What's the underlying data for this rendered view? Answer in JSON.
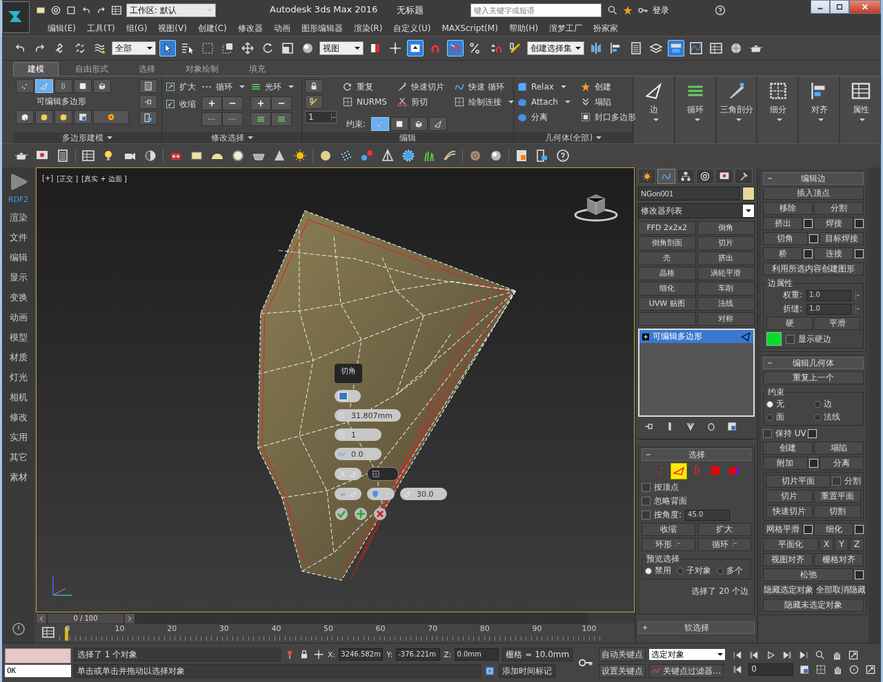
{
  "window": {
    "title": "Autodesk 3ds Max 2016",
    "document": "无标题",
    "workspace": "工作区: 默认",
    "search": {
      "placeholder": "键入关键字或短语"
    },
    "user": "登录"
  },
  "menu": [
    "编辑(E)",
    "工具(T)",
    "组(G)",
    "视图(V)",
    "创建(C)",
    "修改器",
    "动画",
    "图形编辑器",
    "渲染(R)",
    "自定义(U)",
    "MAXScript(M)",
    "帮助(H)",
    "渲梦工厂",
    "扮家家"
  ],
  "main_toolbar": [
    {
      "kind": "undo",
      "on": false
    },
    {
      "kind": "redo",
      "on": false
    },
    {
      "kind": "chain",
      "on": false
    },
    {
      "kind": "unchain",
      "on": false
    },
    {
      "kind": "wave",
      "on": false
    },
    {
      "kind": "dropdown",
      "value": "全部"
    },
    {
      "kind": "cursor",
      "on": true
    },
    {
      "kind": "cursorlist",
      "on": false
    },
    {
      "kind": "marquee",
      "on": false
    },
    {
      "kind": "crossing",
      "on": false
    },
    {
      "kind": "move",
      "on": false
    },
    {
      "kind": "rotate",
      "on": false
    },
    {
      "kind": "scale",
      "on": false
    },
    {
      "kind": "sphere",
      "on": false
    },
    {
      "kind": "dropdown",
      "value": "视图"
    },
    {
      "kind": "pivot",
      "on": false
    },
    {
      "kind": "crosshair",
      "on": false
    },
    {
      "kind": "manipulate",
      "on": true
    },
    {
      "kind": "magnet",
      "on": false
    },
    {
      "kind": "angle",
      "on": true
    },
    {
      "kind": "percent",
      "on": false
    },
    {
      "kind": "spinner",
      "on": false
    },
    {
      "kind": "abc",
      "on": false
    },
    {
      "kind": "dropdown",
      "value": "创建选择集"
    },
    {
      "kind": "mirror",
      "on": false
    },
    {
      "kind": "align",
      "on": false
    },
    {
      "kind": "list",
      "on": false
    },
    {
      "kind": "layers",
      "on": false
    },
    {
      "kind": "ribbon",
      "on": true
    },
    {
      "kind": "curve",
      "on": false
    },
    {
      "kind": "table",
      "on": false
    },
    {
      "kind": "ball",
      "on": false
    },
    {
      "kind": "teapot",
      "on": false
    }
  ],
  "ribbon": {
    "tabs": [
      {
        "label": "建模",
        "selected": true
      },
      {
        "label": "自由形式",
        "selected": false
      },
      {
        "label": "选择",
        "selected": false
      },
      {
        "label": "对象绘制",
        "selected": false
      },
      {
        "label": "填充",
        "selected": false
      }
    ],
    "poly_modeling": {
      "modes": [
        {
          "selected": false
        },
        {
          "selected": true
        },
        {
          "selected": false
        },
        {
          "selected": false
        },
        {
          "selected": false
        }
      ],
      "label": "可编辑多边形",
      "footer": "多边形建模"
    },
    "modify_selection": {
      "grow": "扩大",
      "shrink": "收缩",
      "loop": "循环",
      "ring": "光环",
      "footer": "修改选择"
    },
    "edit": {
      "spinner": "1",
      "items": [
        {
          "label": "重复",
          "menu": false
        },
        {
          "label": "快速切片",
          "menu": false
        },
        {
          "label": "快速 循环",
          "menu": false
        },
        {
          "label": "NURMS",
          "menu": false
        },
        {
          "label": "剪切",
          "menu": false
        },
        {
          "label": "绘制连接",
          "menu": true
        }
      ],
      "constraint_label": "约束:",
      "constraints": [
        {
          "selected": true
        },
        {
          "selected": false
        },
        {
          "selected": false
        },
        {
          "selected": false
        }
      ],
      "footer": "编辑"
    },
    "geometry": {
      "items": [
        {
          "label": "Relax",
          "menu": true
        },
        {
          "label": "创建",
          "menu": false
        },
        {
          "label": "Attach",
          "menu": true
        },
        {
          "label": "塌陷",
          "menu": false
        },
        {
          "label": "分离",
          "menu": false
        },
        {
          "label": "封口多边形",
          "menu": false
        }
      ],
      "footer": "几何体(全部)"
    },
    "big_buttons": [
      "边",
      "循环",
      "三角剖分",
      "细分",
      "对齐",
      "属性"
    ]
  },
  "sidebar": {
    "brand": "RDF2",
    "items": [
      "渲染",
      "文件",
      "编辑",
      "显示",
      "变换",
      "动画",
      "模型",
      "材质",
      "灯光",
      "相机",
      "修改",
      "实用",
      "其它",
      "素材"
    ]
  },
  "viewport": {
    "labels": [
      "[+]",
      "[正交 ]",
      "[真实 + 边面 ]"
    ],
    "caddy": {
      "title": "切角",
      "amount": "31.807mm",
      "segments": "1",
      "tension": "0.0",
      "open_chamfer": false,
      "invert": false,
      "smooth": false,
      "angle": "30.0"
    }
  },
  "command_panel": {
    "tabs": [
      {
        "selected": false
      },
      {
        "selected": true
      },
      {
        "selected": false
      },
      {
        "selected": false
      },
      {
        "selected": false
      },
      {
        "selected": false
      }
    ],
    "object_name": "NGon001",
    "modifier_list": "修改器列表",
    "modifier_buttons": [
      "FFD 2x2x2",
      "倒角",
      "倒角剖面",
      "切片",
      "壳",
      "挤出",
      "晶格",
      "涡轮平滑",
      "细化",
      "车削",
      "UVW 贴图",
      "法线",
      "对称"
    ],
    "stack": [
      {
        "label": "可编辑多边形",
        "selected": true
      }
    ],
    "selection": {
      "title": "选择",
      "expanded": true,
      "levels": [
        {
          "selected": false
        },
        {
          "selected": true
        },
        {
          "selected": false
        },
        {
          "selected": false
        },
        {
          "selected": false
        }
      ],
      "options": [
        {
          "label": "按顶点",
          "checked": false
        },
        {
          "label": "忽略背面",
          "checked": false
        },
        {
          "label": "按角度:",
          "checked": false
        }
      ],
      "angle": "45.0",
      "buttons": [
        "收缩",
        "扩大"
      ],
      "spinner_buttons": [
        "环形",
        "循环"
      ],
      "preview": {
        "title": "预览选择",
        "options": [
          {
            "label": "禁用",
            "selected": true
          },
          {
            "label": "子对象",
            "selected": false
          },
          {
            "label": "多个",
            "selected": false
          }
        ]
      },
      "status": "选择了 20 个边"
    },
    "soft_selection": {
      "title": "软选择",
      "expanded": false
    }
  },
  "edit_edges": {
    "title": "编辑边",
    "expanded": true,
    "rows": [
      [
        {
          "label": "插入顶点",
          "settings": false
        }
      ],
      [
        {
          "label": "移除",
          "settings": false
        },
        {
          "label": "分割",
          "settings": false
        }
      ],
      [
        {
          "label": "挤出",
          "settings": true
        },
        {
          "label": "焊接",
          "settings": true
        }
      ],
      [
        {
          "label": "切角",
          "settings": true
        },
        {
          "label": "目标焊接",
          "settings": false
        }
      ],
      [
        {
          "label": "桥",
          "settings": true
        },
        {
          "label": "连接",
          "settings": true
        }
      ],
      [
        {
          "label": "利用所选内容创建图形",
          "settings": false
        }
      ]
    ],
    "properties": {
      "title": "边属性",
      "weight_label": "权重:",
      "weight": "1.0",
      "crease_label": "折缝:",
      "crease": "1.0",
      "hard": "硬",
      "smooth": "平滑",
      "show_hard": {
        "label": "显示硬边",
        "checked": false
      }
    }
  },
  "edit_geometry": {
    "title": "编辑几何体",
    "expanded": true,
    "repeat": "重复上一个",
    "constraints": {
      "title": "约束",
      "options": [
        {
          "label": "无",
          "selected": true
        },
        {
          "label": "边",
          "selected": false
        },
        {
          "label": "面",
          "selected": false
        },
        {
          "label": "法线",
          "selected": false
        }
      ]
    },
    "preserve_uv": {
      "label": "保持 UV",
      "checked": false
    },
    "rows1": [
      [
        {
          "label": "创建",
          "settings": false
        },
        {
          "label": "塌陷",
          "settings": false
        }
      ],
      [
        {
          "label": "附加",
          "settings": true
        },
        {
          "label": "分离",
          "settings": false
        }
      ]
    ],
    "slice_plane": "切片平面",
    "split": {
      "label": "分割",
      "checked": false
    },
    "slice_rows": [
      [
        {
          "label": "切片",
          "settings": false
        },
        {
          "label": "重置平面",
          "settings": false
        }
      ],
      [
        {
          "label": "快速切片",
          "settings": false
        },
        {
          "label": "切割",
          "settings": false
        }
      ]
    ],
    "rows2": [
      [
        {
          "label": "网格平滑",
          "settings": true
        },
        {
          "label": "细化",
          "settings": true
        }
      ],
      [
        {
          "label": "平面化",
          "settings": false
        },
        {
          "label": "X",
          "settings": false
        },
        {
          "label": "Y",
          "settings": false
        },
        {
          "label": "Z",
          "settings": false
        }
      ],
      [
        {
          "label": "视图对齐",
          "settings": false
        },
        {
          "label": "栅格对齐",
          "settings": false
        }
      ],
      [
        {
          "label": "松弛",
          "settings": true
        }
      ],
      [
        {
          "label": "隐藏选定对象",
          "settings": false
        },
        {
          "label": "全部取消隐藏",
          "settings": false
        }
      ],
      [
        {
          "label": "隐藏未选定对象",
          "settings": false
        }
      ]
    ]
  },
  "timeline": {
    "position": "0 / 100",
    "ticks": [
      "0",
      "10",
      "20",
      "30",
      "40",
      "50",
      "60",
      "70",
      "80",
      "90",
      "100"
    ]
  },
  "status_bar": {
    "script": "OK",
    "message": "选择了 1 个对象",
    "prompt": "单击或单击并拖动以选择对象",
    "coords": [
      {
        "label": "X:",
        "value": "3246.582m"
      },
      {
        "label": "Y:",
        "value": "-376.221m"
      },
      {
        "label": "Z:",
        "value": "0.0mm"
      }
    ],
    "grid": "栅格 = 10.0mm",
    "time_tag": "添加时间标记",
    "auto_key": "自动关键点",
    "key_mode": "选定对象",
    "set_key": "设置关键点",
    "key_filters": "关键点过滤器...",
    "frame": "0"
  }
}
